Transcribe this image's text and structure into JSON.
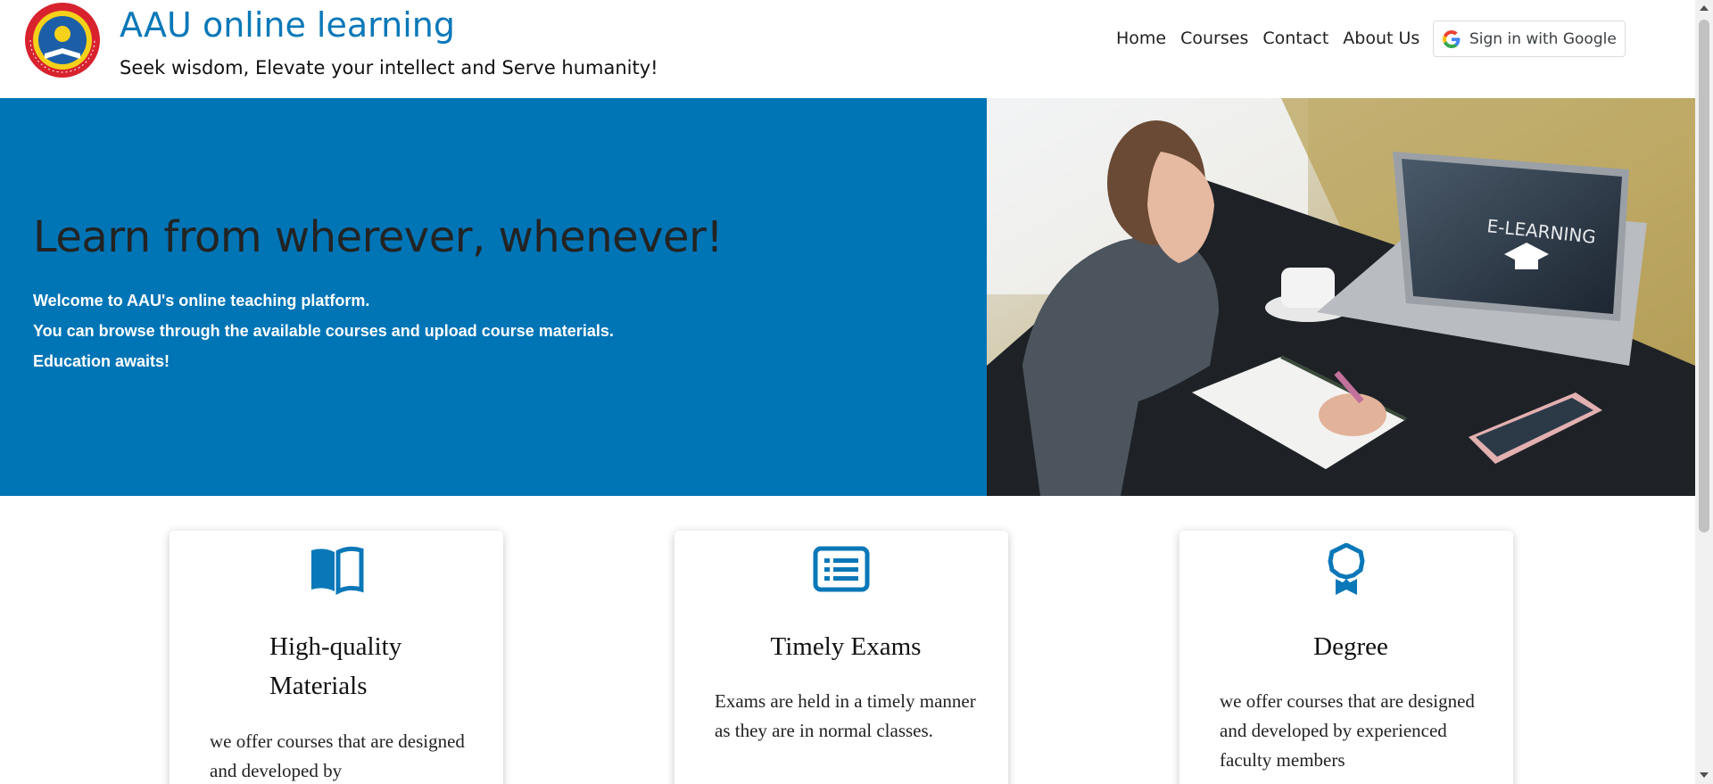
{
  "header": {
    "title": "AAU online learning",
    "tagline": "Seek wisdom, Elevate your intellect and Serve humanity!",
    "logo_text": "ADDIS ABABA UNIVERSITY",
    "nav": [
      "Home",
      "Courses",
      "Contact",
      "About Us"
    ],
    "signin_label": "Sign in with Google"
  },
  "hero": {
    "title": "Learn from wherever, whenever!",
    "lines": [
      "Welcome to AAU's online teaching platform.",
      "You can browse through the available courses and upload course materials.",
      "Education awaits!"
    ],
    "image_caption": "E-LEARNING"
  },
  "cards": [
    {
      "icon": "book-icon",
      "title": "High-quality Materials",
      "text": "we offer courses that are designed and developed by"
    },
    {
      "icon": "list-icon",
      "title": "Timely Exams",
      "text": "Exams are held in a timely manner as they are in normal classes."
    },
    {
      "icon": "award-icon",
      "title": "Degree",
      "text": "we offer courses that are designed and developed by experienced faculty members"
    }
  ],
  "colors": {
    "brand": "#0a78b8",
    "hero_bg": "#0075b6",
    "icon": "#0a78b8"
  }
}
